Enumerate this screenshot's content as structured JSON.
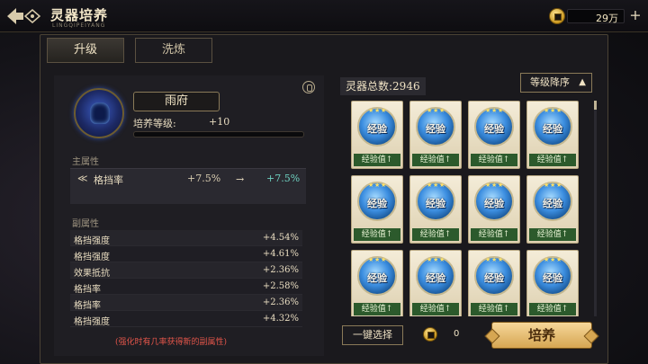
{
  "header": {
    "title": "灵器培养",
    "subtitle": "LINGQIPEIYANG",
    "currency_value": "29万"
  },
  "tabs": [
    {
      "label": "升级",
      "active": true
    },
    {
      "label": "洗炼",
      "active": false
    }
  ],
  "item": {
    "name": "雨府",
    "level_label": "培养等级:",
    "level_value": "+10",
    "level_progress": 0
  },
  "main_attr": {
    "section_label": "主属性",
    "name": "格挡率",
    "current": "+7.5%",
    "next": "+7.5%"
  },
  "sub_attrs": {
    "section_label": "副属性",
    "rows": [
      {
        "name": "格挡强度",
        "value": "+4.54%"
      },
      {
        "name": "格挡强度",
        "value": "+4.61%"
      },
      {
        "name": "效果抵抗",
        "value": "+2.36%"
      },
      {
        "name": "格挡率",
        "value": "+2.58%"
      },
      {
        "name": "格挡率",
        "value": "+2.36%"
      },
      {
        "name": "格挡强度",
        "value": "+4.32%"
      }
    ]
  },
  "hint": "(强化时有几率获得新的副属性)",
  "inventory": {
    "total_label": "灵器总数:",
    "total_value": "2946",
    "sort_label": "等级降序",
    "card_text": "经验",
    "card_label": "经验值↑"
  },
  "footer": {
    "onekey_label": "一键选择",
    "cost": "0",
    "cultivate_label": "培养"
  },
  "colors": {
    "accent_gold": "#d6a652",
    "new_value": "#6ed0c0",
    "hint_red": "#e2554a"
  }
}
